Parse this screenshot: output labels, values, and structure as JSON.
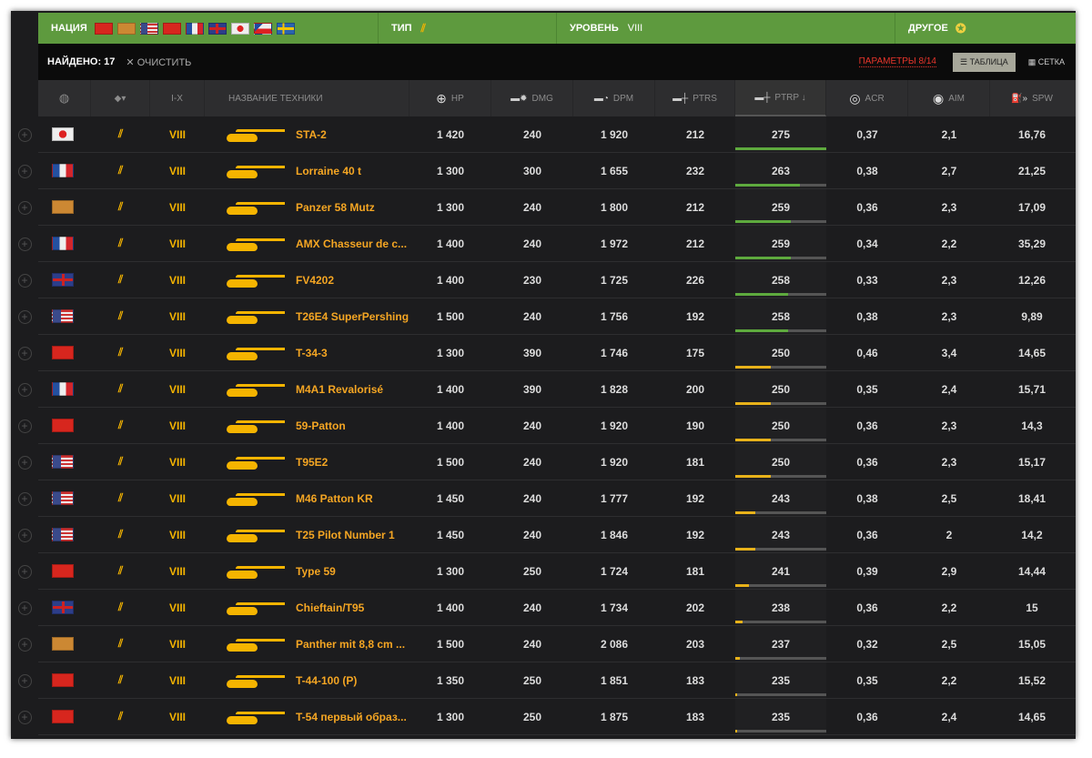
{
  "filters": {
    "nation_label": "НАЦИЯ",
    "nations": [
      "ussr",
      "germany",
      "usa",
      "china",
      "france",
      "uk",
      "japan",
      "czech",
      "sweden"
    ],
    "type_label": "ТИП",
    "level_label": "УРОВЕНЬ",
    "level_value": "VIII",
    "other_label": "ДРУГОЕ"
  },
  "toolbar": {
    "found": "НАЙДЕНО: 17",
    "clear": "ОЧИСТИТЬ",
    "params": "ПАРАМЕТРЫ 8/14",
    "table": "ТАБЛИЦА",
    "grid": "СЕТКА"
  },
  "header": {
    "tier": "I-X",
    "name": "НАЗВАНИЕ ТЕХНИКИ",
    "hp": "HP",
    "dmg": "DMG",
    "dpm": "DPM",
    "ptrs": "PTRS",
    "ptrp": "PTRP ↓",
    "acr": "ACR",
    "aim": "AIM",
    "spw": "SPW"
  },
  "colors": {
    "bar_high": "#5eaa3e",
    "bar_low": "#e8b21a",
    "accent": "#f5a623",
    "params": "#e8352b"
  },
  "rows": [
    {
      "nation": "japan",
      "tier": "VIII",
      "name": "STA-2",
      "hp": "1 420",
      "dmg": "240",
      "dpm": "1 920",
      "ptrs": "212",
      "ptrp": "275",
      "ptrp_fill": 1.0,
      "acr": "0,37",
      "aim": "2,1",
      "spw": "16,76"
    },
    {
      "nation": "france",
      "tier": "VIII",
      "name": "Lorraine 40 t",
      "hp": "1 300",
      "dmg": "300",
      "dpm": "1 655",
      "ptrs": "232",
      "ptrp": "263",
      "ptrp_fill": 0.71,
      "acr": "0,38",
      "aim": "2,7",
      "spw": "21,25"
    },
    {
      "nation": "germany",
      "tier": "VIII",
      "name": "Panzer 58 Mutz",
      "hp": "1 300",
      "dmg": "240",
      "dpm": "1 800",
      "ptrs": "212",
      "ptrp": "259",
      "ptrp_fill": 0.61,
      "acr": "0,36",
      "aim": "2,3",
      "spw": "17,09"
    },
    {
      "nation": "france",
      "tier": "VIII",
      "name": "AMX Chasseur de c...",
      "hp": "1 400",
      "dmg": "240",
      "dpm": "1 972",
      "ptrs": "212",
      "ptrp": "259",
      "ptrp_fill": 0.61,
      "acr": "0,34",
      "aim": "2,2",
      "spw": "35,29"
    },
    {
      "nation": "uk",
      "tier": "VIII",
      "name": "FV4202",
      "hp": "1 400",
      "dmg": "230",
      "dpm": "1 725",
      "ptrs": "226",
      "ptrp": "258",
      "ptrp_fill": 0.58,
      "acr": "0,33",
      "aim": "2,3",
      "spw": "12,26"
    },
    {
      "nation": "usa",
      "tier": "VIII",
      "name": "T26E4 SuperPershing",
      "hp": "1 500",
      "dmg": "240",
      "dpm": "1 756",
      "ptrs": "192",
      "ptrp": "258",
      "ptrp_fill": 0.58,
      "acr": "0,38",
      "aim": "2,3",
      "spw": "9,89"
    },
    {
      "nation": "china",
      "tier": "VIII",
      "name": "T-34-3",
      "hp": "1 300",
      "dmg": "390",
      "dpm": "1 746",
      "ptrs": "175",
      "ptrp": "250",
      "ptrp_fill": 0.39,
      "acr": "0,46",
      "aim": "3,4",
      "spw": "14,65"
    },
    {
      "nation": "france",
      "tier": "VIII",
      "name": "M4A1 Revalorisé",
      "hp": "1 400",
      "dmg": "390",
      "dpm": "1 828",
      "ptrs": "200",
      "ptrp": "250",
      "ptrp_fill": 0.39,
      "acr": "0,35",
      "aim": "2,4",
      "spw": "15,71"
    },
    {
      "nation": "china",
      "tier": "VIII",
      "name": "59-Patton",
      "hp": "1 400",
      "dmg": "240",
      "dpm": "1 920",
      "ptrs": "190",
      "ptrp": "250",
      "ptrp_fill": 0.39,
      "acr": "0,36",
      "aim": "2,3",
      "spw": "14,3"
    },
    {
      "nation": "usa",
      "tier": "VIII",
      "name": "T95E2",
      "hp": "1 500",
      "dmg": "240",
      "dpm": "1 920",
      "ptrs": "181",
      "ptrp": "250",
      "ptrp_fill": 0.39,
      "acr": "0,36",
      "aim": "2,3",
      "spw": "15,17"
    },
    {
      "nation": "usa",
      "tier": "VIII",
      "name": "M46 Patton KR",
      "hp": "1 450",
      "dmg": "240",
      "dpm": "1 777",
      "ptrs": "192",
      "ptrp": "243",
      "ptrp_fill": 0.22,
      "acr": "0,38",
      "aim": "2,5",
      "spw": "18,41"
    },
    {
      "nation": "usa",
      "tier": "VIII",
      "name": "T25 Pilot Number 1",
      "hp": "1 450",
      "dmg": "240",
      "dpm": "1 846",
      "ptrs": "192",
      "ptrp": "243",
      "ptrp_fill": 0.22,
      "acr": "0,36",
      "aim": "2",
      "spw": "14,2"
    },
    {
      "nation": "china",
      "tier": "VIII",
      "name": "Type 59",
      "hp": "1 300",
      "dmg": "250",
      "dpm": "1 724",
      "ptrs": "181",
      "ptrp": "241",
      "ptrp_fill": 0.15,
      "acr": "0,39",
      "aim": "2,9",
      "spw": "14,44"
    },
    {
      "nation": "uk",
      "tier": "VIII",
      "name": "Chieftain/T95",
      "hp": "1 400",
      "dmg": "240",
      "dpm": "1 734",
      "ptrs": "202",
      "ptrp": "238",
      "ptrp_fill": 0.08,
      "acr": "0,36",
      "aim": "2,2",
      "spw": "15"
    },
    {
      "nation": "germany",
      "tier": "VIII",
      "name": "Panther mit 8,8 cm ...",
      "hp": "1 500",
      "dmg": "240",
      "dpm": "2 086",
      "ptrs": "203",
      "ptrp": "237",
      "ptrp_fill": 0.05,
      "acr": "0,32",
      "aim": "2,5",
      "spw": "15,05"
    },
    {
      "nation": "ussr",
      "tier": "VIII",
      "name": "T-44-100 (P)",
      "hp": "1 350",
      "dmg": "250",
      "dpm": "1 851",
      "ptrs": "183",
      "ptrp": "235",
      "ptrp_fill": 0.02,
      "acr": "0,35",
      "aim": "2,2",
      "spw": "15,52"
    },
    {
      "nation": "ussr",
      "tier": "VIII",
      "name": "T-54 первый образ...",
      "hp": "1 300",
      "dmg": "250",
      "dpm": "1 875",
      "ptrs": "183",
      "ptrp": "235",
      "ptrp_fill": 0.02,
      "acr": "0,36",
      "aim": "2,4",
      "spw": "14,65"
    }
  ]
}
